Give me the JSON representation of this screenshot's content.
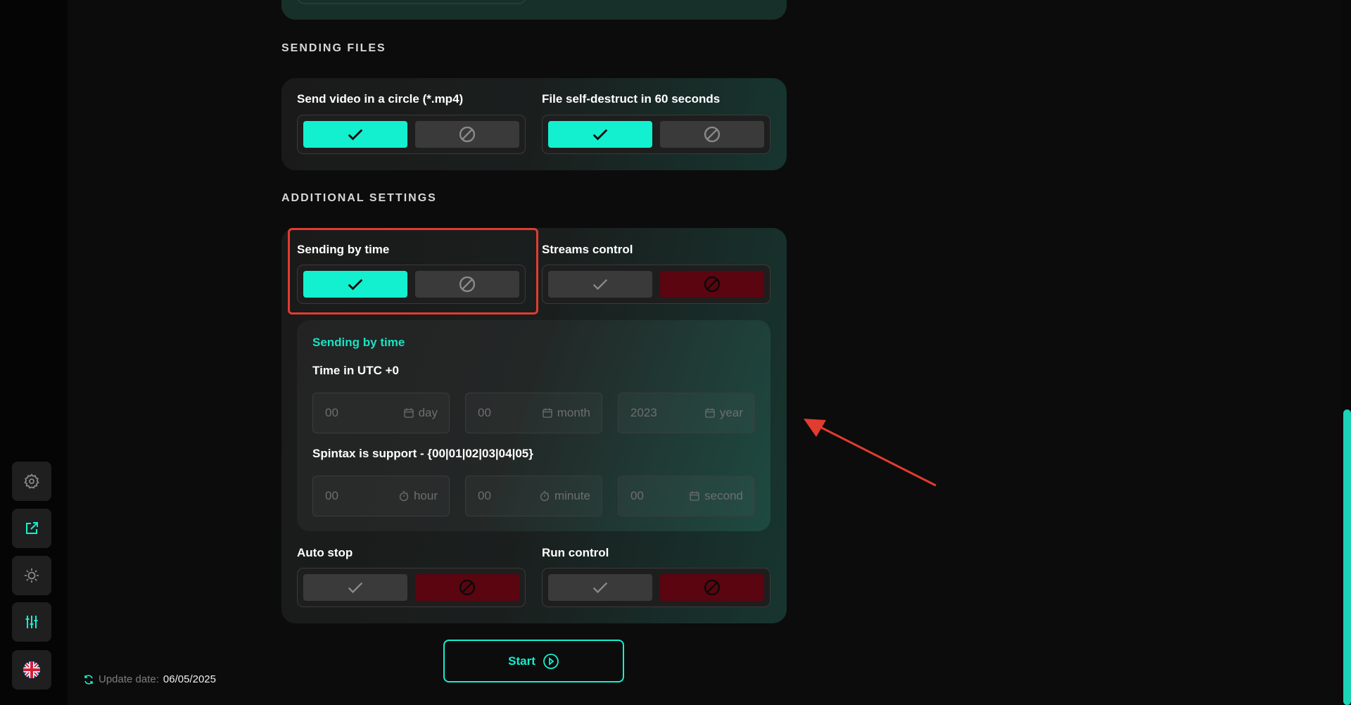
{
  "sections": {
    "sending_files": "SENDING FILES",
    "additional_settings": "ADDITIONAL SETTINGS"
  },
  "sending_files": {
    "video_circle": {
      "label": "Send video in a circle (*.mp4)",
      "enabled": true
    },
    "self_destruct": {
      "label": "File self-destruct in 60 seconds",
      "enabled": true
    }
  },
  "additional": {
    "sending_by_time": {
      "label": "Sending by time",
      "enabled": true
    },
    "streams_control": {
      "label": "Streams control",
      "enabled": false
    },
    "auto_stop": {
      "label": "Auto stop",
      "enabled": false
    },
    "run_control": {
      "label": "Run control",
      "enabled": false
    }
  },
  "time_panel": {
    "title": "Sending by time",
    "utc_label": "Time in UTC +0",
    "spintax_label": "Spintax is support - {00|01|02|03|04|05}",
    "day": {
      "placeholder": "00",
      "unit": "day",
      "icon": "calendar-icon"
    },
    "month": {
      "placeholder": "00",
      "unit": "month",
      "icon": "calendar-icon"
    },
    "year": {
      "placeholder": "2023",
      "unit": "year",
      "icon": "calendar-icon"
    },
    "hour": {
      "placeholder": "00",
      "unit": "hour",
      "icon": "stopwatch-icon"
    },
    "minute": {
      "placeholder": "00",
      "unit": "minute",
      "icon": "stopwatch-icon"
    },
    "second": {
      "placeholder": "00",
      "unit": "second",
      "icon": "calendar-icon"
    }
  },
  "start_button": {
    "label": "Start"
  },
  "update": {
    "label": "Update date:",
    "value": "06/05/2025"
  },
  "sidebar": {
    "items": [
      {
        "icon": "gear-icon"
      },
      {
        "icon": "external-link-icon",
        "active": true
      },
      {
        "icon": "sun-icon"
      },
      {
        "icon": "sliders-icon",
        "active": true
      },
      {
        "icon": "uk-flag-icon"
      }
    ]
  },
  "colors": {
    "accent": "#13f0cf",
    "disabled_red": "#5a0510",
    "annotation": "#e23b30"
  }
}
